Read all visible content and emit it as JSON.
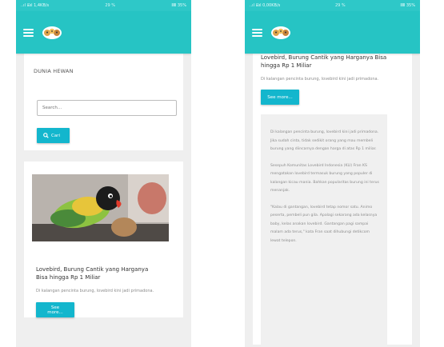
{
  "statusbar": {
    "left_text": "..ıl ⊞ıl 1,4KB/s",
    "middle_text": "29 %",
    "right_text": "ⅡⅢ 35%",
    "right_phone_left_text": "..ıl ⊞ıl 0,00KB/s",
    "right_phone_middle_text": "29 %",
    "right_phone_right_text": "ⅡⅢ 35%"
  },
  "colors": {
    "appbar": "#26c4c4",
    "button": "#13b6cd"
  },
  "icons": {
    "menu": "hamburger-icon",
    "logo": "paw-logo-icon",
    "search": "search-icon"
  },
  "left": {
    "site_title": "DUNIA HEWAN",
    "search_placeholder": "Search...",
    "search_button": "Cari",
    "post": {
      "title": "Lovebird, Burung Cantik yang Harganya Bisa hingga Rp 1 Miliar",
      "excerpt": "Di kalangan pencinta burung, lovebird kini jadi primadona.",
      "button": "See more..."
    }
  },
  "right": {
    "post": {
      "title": "Lovebird, Burung Cantik yang Harganya Bisa hingga Rp 1 Miliar",
      "excerpt": "Di kalangan pencinta burung, lovebird kini jadi primadona.",
      "button": "See more..."
    },
    "article": {
      "p1": "Di kalangan pencinta burung, lovebird kini jadi primadona. Jika sudah cinta, tidak sedikit orang yang mau membeli burung yang diincarnya dengan harga di atas Rp 1 miliar.",
      "p2": "Sesepuh Komunitas Lovebird Indonesia (KLI) Fran KS mengatakan lovebird termasuk burung yang populer di kalangan kicau mania. Bahkan popularitas burung ini terus menanjak.",
      "p3": "\"Kalau di gantangan, lovebird tetap nomor satu. Animo peserta, pembeli pun gila. Apalagi sekarang ada kelasnya baby, kelas anakan lovebird. Gantangan pagi sampai malam ada terus,\" kata Fran saat dihubungi detikcom lewat telepon."
    }
  }
}
